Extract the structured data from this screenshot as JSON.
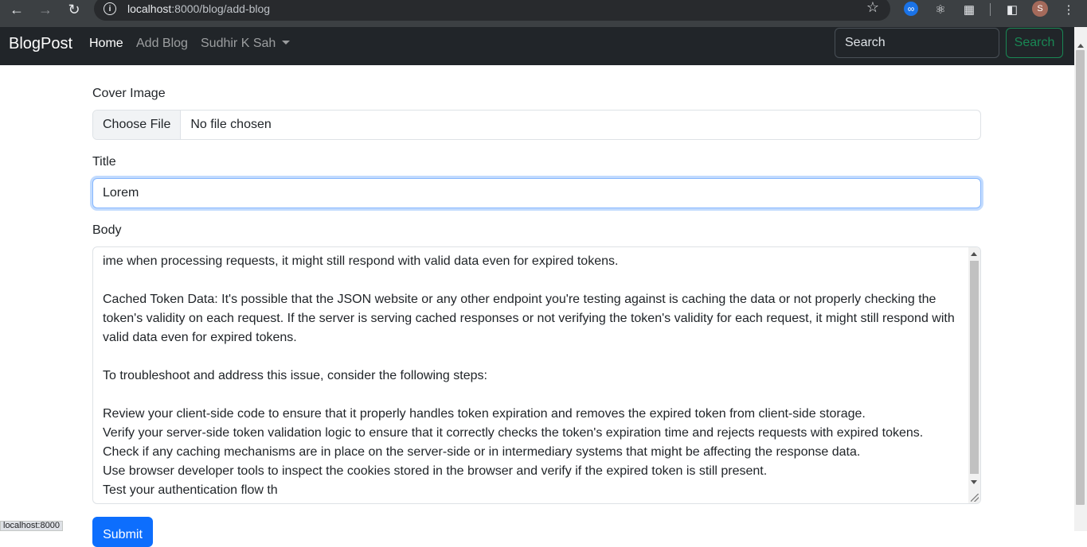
{
  "browser": {
    "url_host": "localhost",
    "url_rest": ":8000/blog/add-blog",
    "avatar_initial": "S"
  },
  "navbar": {
    "brand": "BlogPost",
    "links": [
      {
        "label": "Home"
      },
      {
        "label": "Add Blog"
      },
      {
        "label": "Sudhir K Sah"
      }
    ],
    "search_placeholder": "Search",
    "search_button": "Search"
  },
  "form": {
    "cover_label": "Cover Image",
    "choose_file": "Choose File",
    "no_file": "No file chosen",
    "title_label": "Title",
    "title_value": "Lorem",
    "body_label": "Body",
    "body_text": "ime when processing requests, it might still respond with valid data even for expired tokens.\n\nCached Token Data: It's possible that the JSON website or any other endpoint you're testing against is caching the data or not properly checking the token's validity on each request. If the server is serving cached responses or not verifying the token's validity for each request, it might still respond with valid data even for expired tokens.\n\nTo troubleshoot and address this issue, consider the following steps:\n\nReview your client-side code to ensure that it properly handles token expiration and removes the expired token from client-side storage.\nVerify your server-side token validation logic to ensure that it correctly checks the token's expiration time and rejects requests with expired tokens.\nCheck if any caching mechanisms are in place on the server-side or in intermediary systems that might be affecting the response data.\nUse browser developer tools to inspect the cookies stored in the browser and verify if the expired token is still present.\nTest your authentication flow th",
    "submit": "Submit"
  },
  "status_bar": "localhost:8000",
  "colors": {
    "navbar_bg": "#212529",
    "search_green": "#198754",
    "primary": "#0d6efd"
  }
}
